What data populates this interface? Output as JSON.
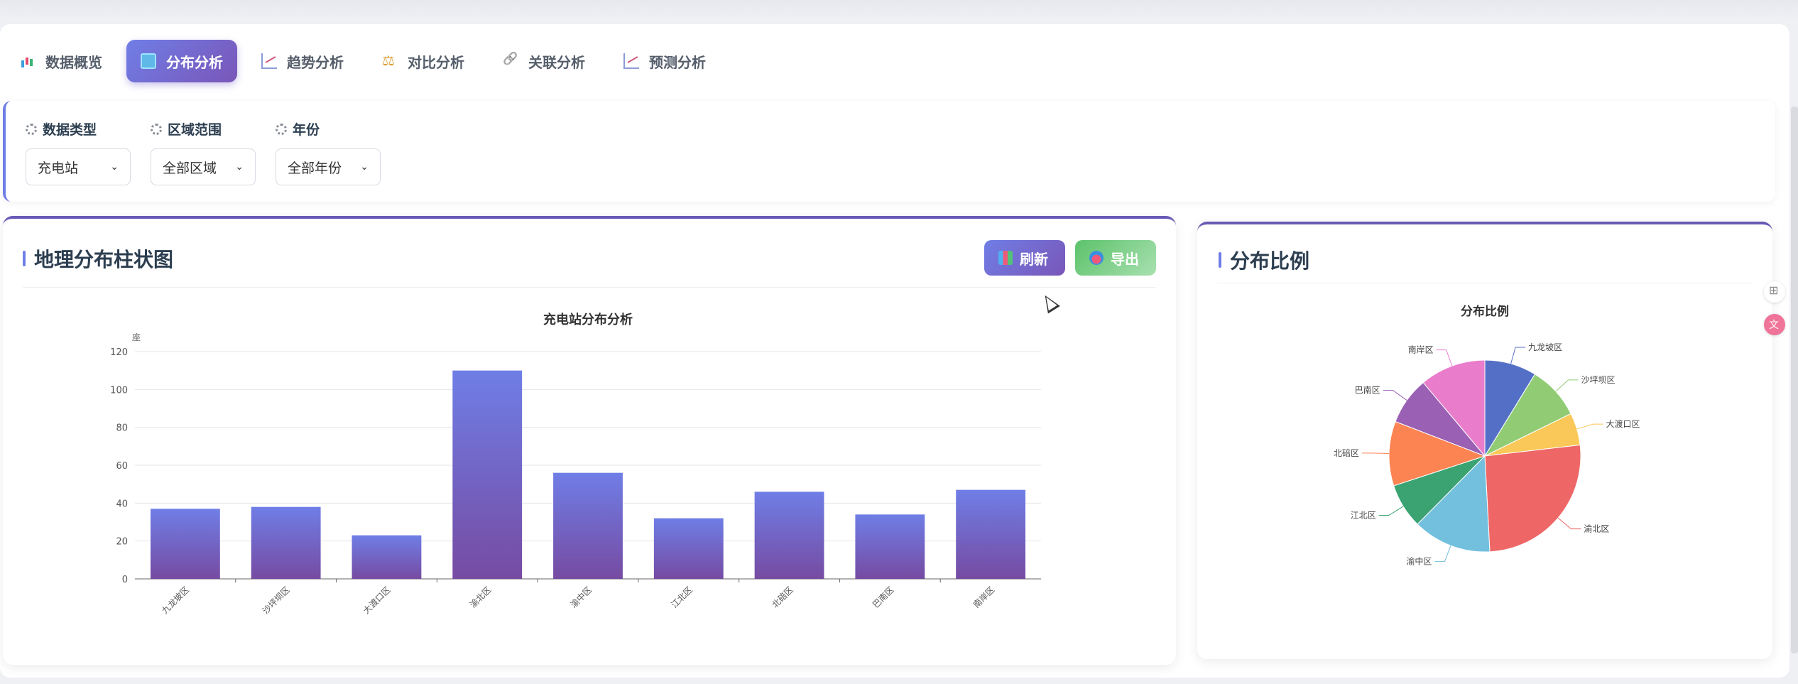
{
  "tabs": [
    {
      "label": "数据概览",
      "icon": "bar-chart-icon",
      "active": false
    },
    {
      "label": "分布分析",
      "icon": "book-icon",
      "active": true
    },
    {
      "label": "趋势分析",
      "icon": "trend-chart-icon",
      "active": false
    },
    {
      "label": "对比分析",
      "icon": "scale-icon",
      "active": false
    },
    {
      "label": "关联分析",
      "icon": "link-icon",
      "active": false
    },
    {
      "label": "预测分析",
      "icon": "forecast-chart-icon",
      "active": false
    }
  ],
  "filters": [
    {
      "label": "数据类型",
      "value": "充电站"
    },
    {
      "label": "区域范围",
      "value": "全部区域"
    },
    {
      "label": "年份",
      "value": "全部年份"
    }
  ],
  "bar_card": {
    "title": "地理分布柱状图",
    "refresh_label": "刷新",
    "export_label": "导出"
  },
  "pie_card": {
    "title": "分布比例"
  },
  "colors": {
    "accent": "#6f7ee6",
    "accent_dark": "#7a56b8",
    "bar_top": "#6f7ee6",
    "bar_bottom": "#764ba2",
    "export_green": "#5cc26a"
  },
  "chart_data": [
    {
      "type": "bar",
      "title": "充电站分布分析",
      "ylabel": "座",
      "categories": [
        "九龙坡区",
        "沙坪坝区",
        "大渡口区",
        "渝北区",
        "渝中区",
        "江北区",
        "北碚区",
        "巴南区",
        "南岸区"
      ],
      "values": [
        37,
        38,
        23,
        110,
        56,
        32,
        46,
        34,
        47
      ],
      "ylim": [
        0,
        120
      ],
      "yticks": [
        0,
        20,
        40,
        60,
        80,
        100,
        120
      ],
      "grid": true
    },
    {
      "type": "pie",
      "title": "分布比例",
      "labels": [
        "九龙坡区",
        "沙坪坝区",
        "大渡口区",
        "渝北区",
        "渝中区",
        "江北区",
        "北碚区",
        "巴南区",
        "南岸区"
      ],
      "values": [
        37,
        38,
        23,
        110,
        56,
        32,
        46,
        34,
        47
      ],
      "colors": [
        "#5470c6",
        "#91cc75",
        "#fac858",
        "#ee6666",
        "#73c0de",
        "#3ba272",
        "#fc8452",
        "#9a60b4",
        "#ea7ccc"
      ]
    }
  ]
}
